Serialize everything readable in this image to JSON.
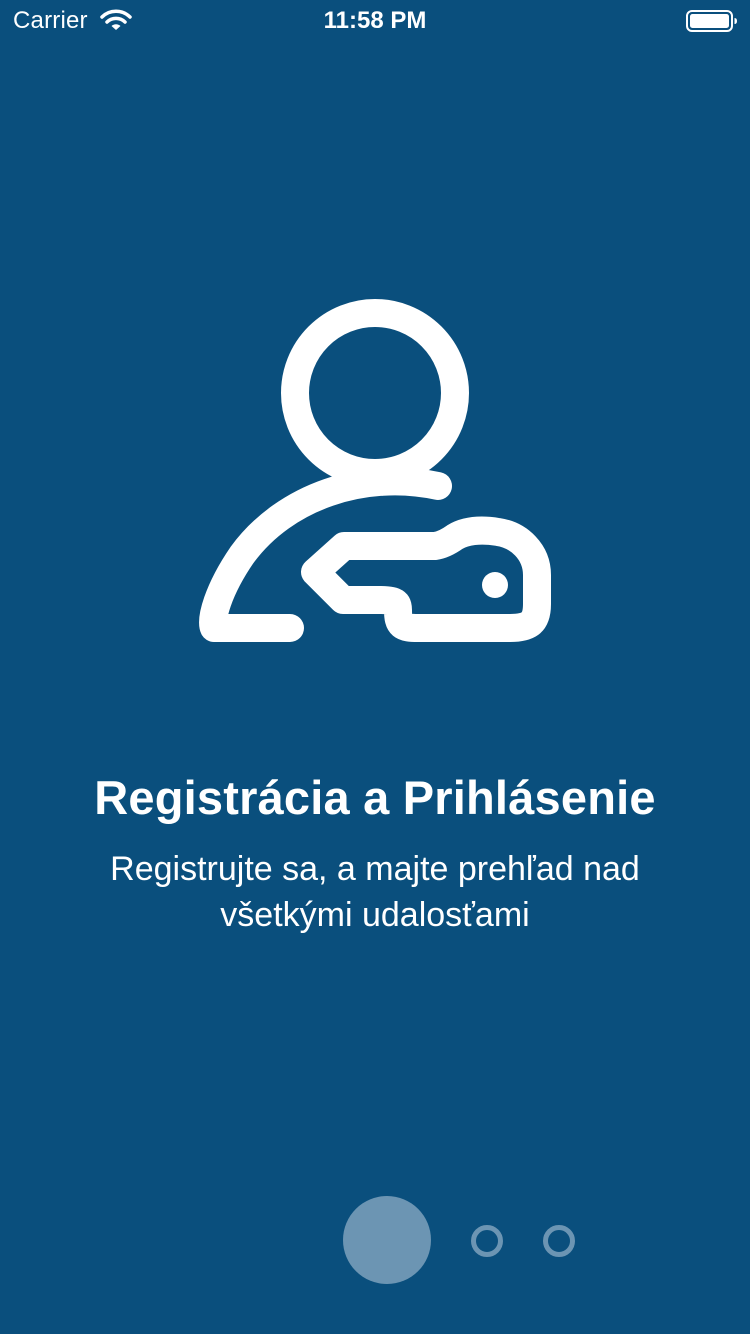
{
  "status_bar": {
    "carrier": "Carrier",
    "time": "11:58 PM",
    "wifi_icon": "wifi-icon",
    "battery_icon": "battery-full-icon"
  },
  "onboarding": {
    "icon": "user-key-icon",
    "title": "Registrácia a Prihlásenie",
    "subtitle": "Registrujte sa, a majte prehľad nad všetkými udalosťami"
  },
  "pager": {
    "page_count": 3,
    "current_page": 1
  },
  "colors": {
    "background": "#0a4f7d",
    "foreground": "#ffffff",
    "pager_dot": "#6c95b3"
  }
}
